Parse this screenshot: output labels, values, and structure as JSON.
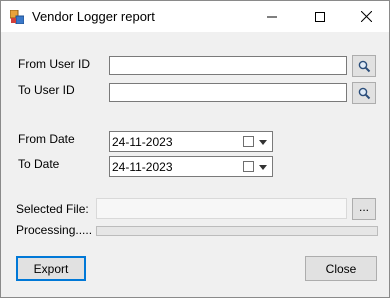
{
  "window": {
    "title": "Vendor Logger report"
  },
  "form": {
    "from_user_id_label": "From User ID",
    "from_user_id_value": "",
    "to_user_id_label": "To User ID",
    "to_user_id_value": "",
    "from_date_label": "From Date",
    "from_date_value": "24-11-2023",
    "to_date_label": "To Date",
    "to_date_value": "24-11-2023",
    "selected_file_label": "Selected File:",
    "selected_file_value": "",
    "browse_label": "...",
    "processing_label": "Processing.....",
    "progress": 0
  },
  "buttons": {
    "export_label": "Export",
    "close_label": "Close"
  },
  "icons": {
    "search": "search-icon",
    "calendar": "calendar-icon",
    "minimize": "minimize-icon",
    "maximize": "maximize-icon",
    "close": "close-icon"
  }
}
